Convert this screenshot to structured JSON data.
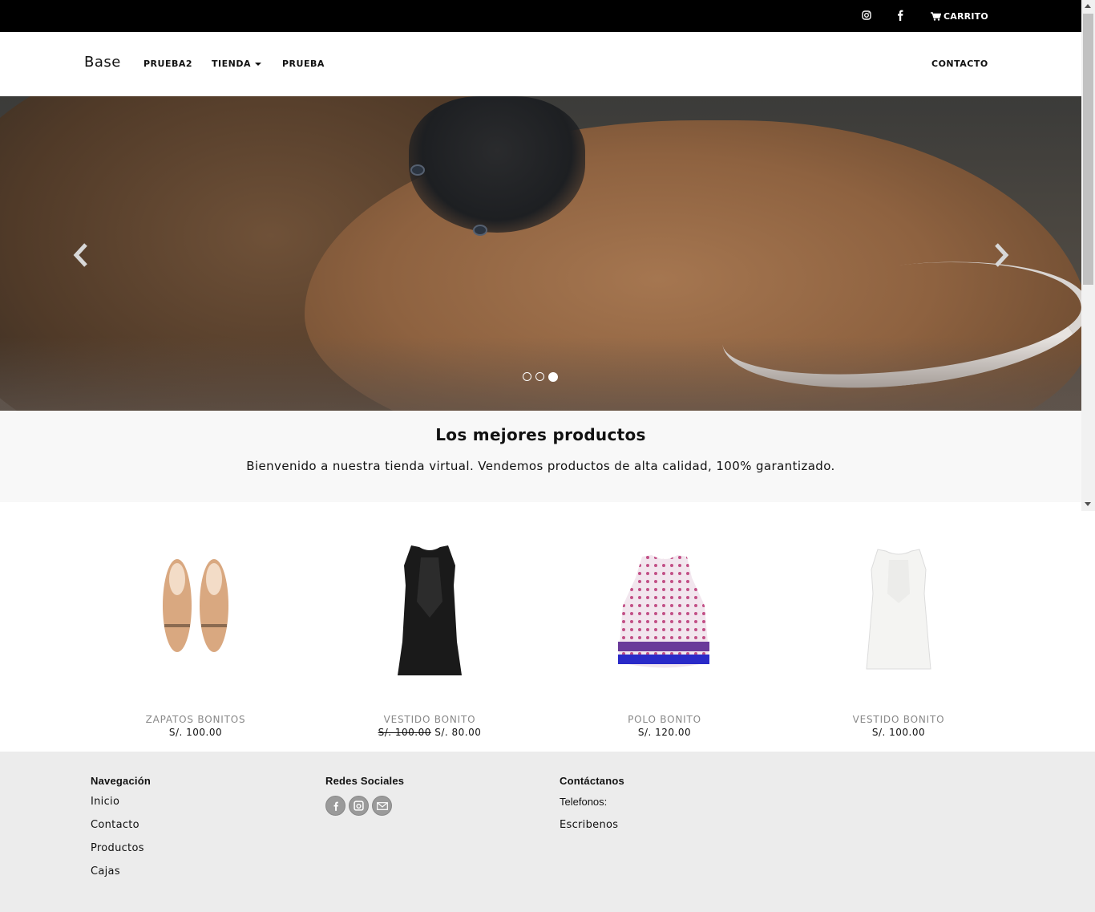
{
  "topbar": {
    "instagram_icon": "instagram-icon",
    "facebook_icon": "facebook-icon",
    "cart_label": "CARRITO"
  },
  "nav": {
    "brand": "Base",
    "items": [
      {
        "label": "PRUEBA2"
      },
      {
        "label": "TIENDA"
      },
      {
        "label": "PRUEBA"
      }
    ],
    "contact": "CONTACTO"
  },
  "hero": {
    "slide_count": 3,
    "active_slide": 3
  },
  "welcome": {
    "title": "Los mejores productos",
    "text": "Bienvenido a nuestra tienda virtual. Vendemos productos de alta calidad, 100% garantizado."
  },
  "products": [
    {
      "name": "ZAPATOS BONITOS",
      "price": "S/. 100.00",
      "old_price": ""
    },
    {
      "name": "VESTIDO BONITO",
      "price": "S/. 80.00",
      "old_price": "S/. 100.00"
    },
    {
      "name": "POLO BONITO",
      "price": "S/. 120.00",
      "old_price": ""
    },
    {
      "name": "VESTIDO BONITO",
      "price": "S/. 100.00",
      "old_price": ""
    }
  ],
  "footer": {
    "nav_title": "Navegación",
    "nav_links": [
      "Inicio",
      "Contacto",
      "Productos",
      "Cajas"
    ],
    "social_title": "Redes Sociales",
    "contact_title": "Contáctanos",
    "phones_label": "Telefonos:",
    "write_label": "Escribenos"
  },
  "colors": {
    "topbar": "#000000",
    "welcome_bg": "#f8f8f8",
    "footer_bg": "#ececec",
    "product_name": "#888888"
  }
}
